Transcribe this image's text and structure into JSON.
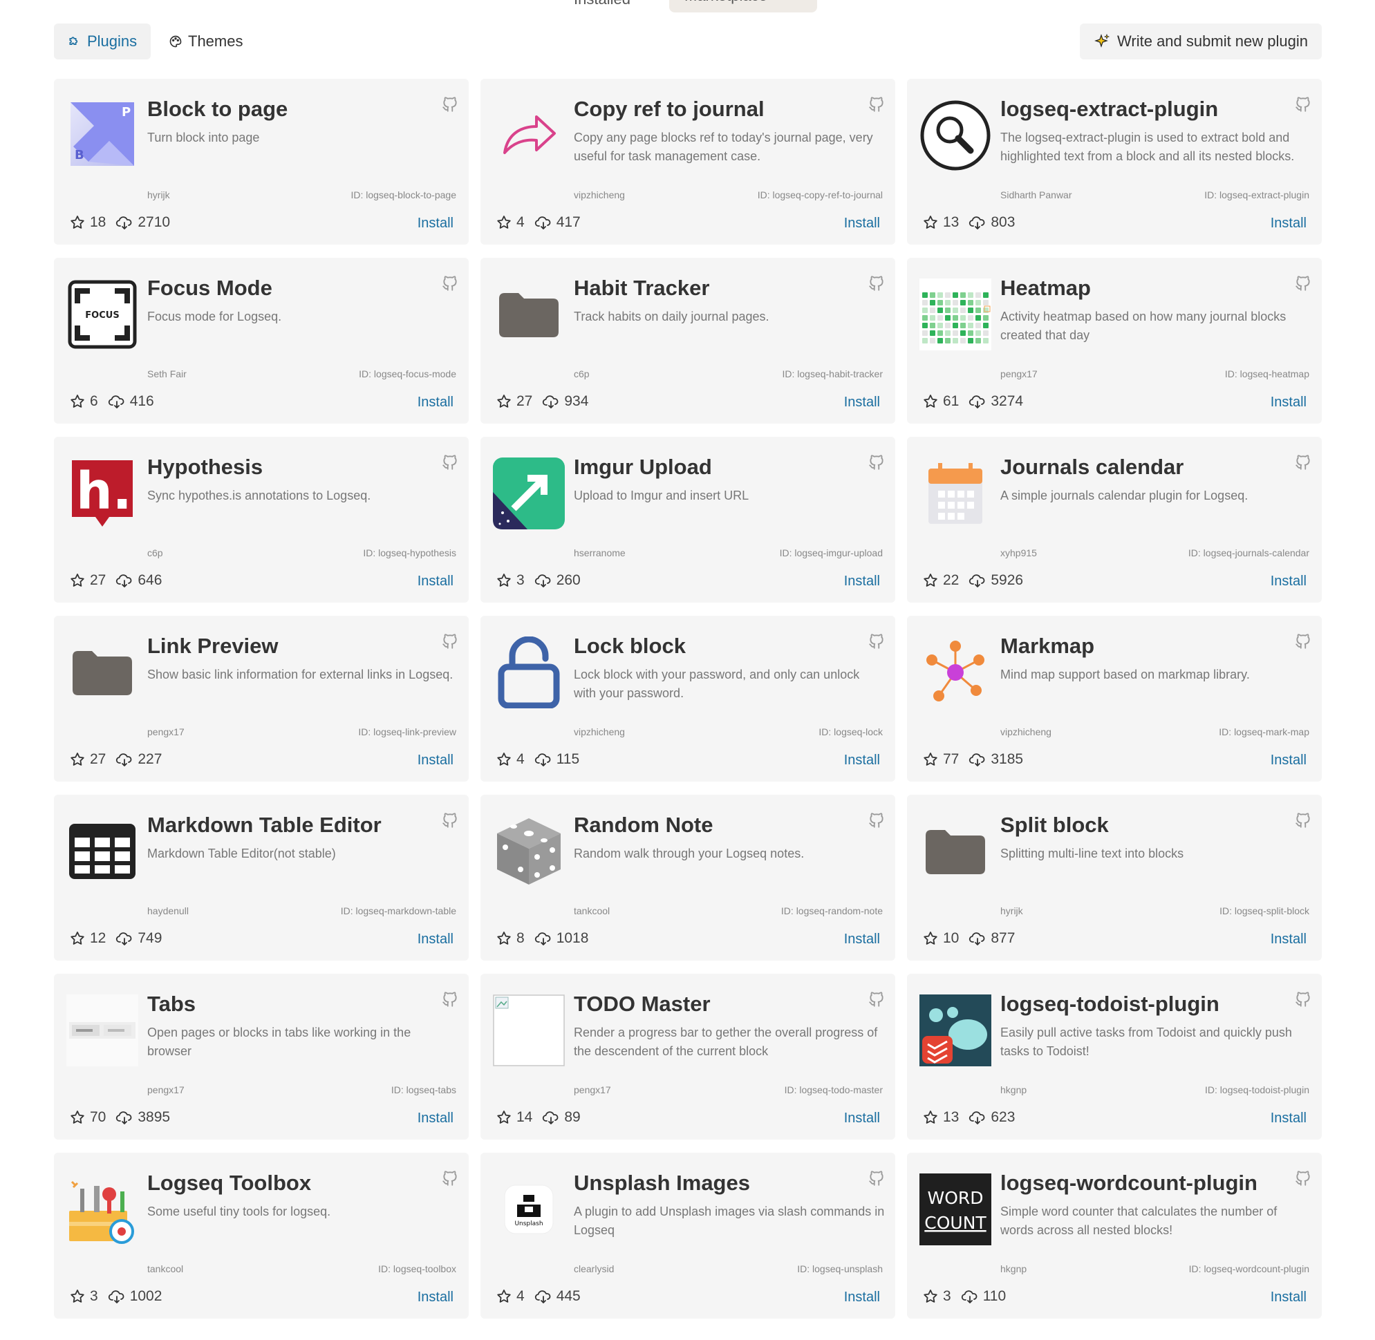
{
  "top_tabs": {
    "installed": "Installed",
    "marketplace": "Marketplace"
  },
  "toolbar": {
    "plugins_label": "Plugins",
    "themes_label": "Themes",
    "write_label": "Write and submit new plugin"
  },
  "install_label": "Install",
  "plugins": [
    {
      "title": "Block to page",
      "desc": "Turn block into page",
      "author": "hyrijk",
      "id": "ID: logseq-block-to-page",
      "stars": "18",
      "downloads": "2710",
      "icon": "block-to-page-icon"
    },
    {
      "title": "Copy ref to journal",
      "desc": "Copy any page blocks ref to today's journal page, very useful for task management case.",
      "author": "vipzhicheng",
      "id": "ID: logseq-copy-ref-to-journal",
      "stars": "4",
      "downloads": "417",
      "icon": "share-arrow-icon"
    },
    {
      "title": "logseq-extract-plugin",
      "desc": "The logseq-extract-plugin is used to extract bold and highlighted text from a block and all its nested blocks.",
      "author": "Sidharth Panwar",
      "id": "ID: logseq-extract-plugin",
      "stars": "13",
      "downloads": "803",
      "icon": "magnifier-icon"
    },
    {
      "title": "Focus Mode",
      "desc": "Focus mode for Logseq.",
      "author": "Seth Fair",
      "id": "ID: logseq-focus-mode",
      "stars": "6",
      "downloads": "416",
      "icon": "focus-icon",
      "icon_text": "FOCUS"
    },
    {
      "title": "Habit Tracker",
      "desc": "Track habits on daily journal pages.",
      "author": "c6p",
      "id": "ID: logseq-habit-tracker",
      "stars": "27",
      "downloads": "934",
      "icon": "folder-icon"
    },
    {
      "title": "Heatmap",
      "desc": "Activity heatmap based on how many journal blocks created that day",
      "author": "pengx17",
      "id": "ID: logseq-heatmap",
      "stars": "61",
      "downloads": "3274",
      "icon": "heatmap-icon"
    },
    {
      "title": "Hypothesis",
      "desc": "Sync hypothes.is annotations to Logseq.",
      "author": "c6p",
      "id": "ID: logseq-hypothesis",
      "stars": "27",
      "downloads": "646",
      "icon": "hypothesis-icon"
    },
    {
      "title": "Imgur Upload",
      "desc": "Upload to Imgur and insert URL",
      "author": "hserranome",
      "id": "ID: logseq-imgur-upload",
      "stars": "3",
      "downloads": "260",
      "icon": "imgur-icon"
    },
    {
      "title": "Journals calendar",
      "desc": "A simple journals calendar plugin for Logseq.",
      "author": "xyhp915",
      "id": "ID: logseq-journals-calendar",
      "stars": "22",
      "downloads": "5926",
      "icon": "calendar-icon"
    },
    {
      "title": "Link Preview",
      "desc": "Show basic link information for external links in Logseq.",
      "author": "pengx17",
      "id": "ID: logseq-link-preview",
      "stars": "27",
      "downloads": "227",
      "icon": "folder-icon"
    },
    {
      "title": "Lock block",
      "desc": "Lock block with your password, and only can unlock with your password.",
      "author": "vipzhicheng",
      "id": "ID: logseq-lock",
      "stars": "4",
      "downloads": "115",
      "icon": "unlock-icon"
    },
    {
      "title": "Markmap",
      "desc": "Mind map support based on markmap library.",
      "author": "vipzhicheng",
      "id": "ID: logseq-mark-map",
      "stars": "77",
      "downloads": "3185",
      "icon": "markmap-icon"
    },
    {
      "title": "Markdown Table Editor",
      "desc": "Markdown Table Editor(not stable)",
      "author": "haydenull",
      "id": "ID: logseq-markdown-table",
      "stars": "12",
      "downloads": "749",
      "icon": "table-icon"
    },
    {
      "title": "Random Note",
      "desc": "Random walk through your Logseq notes.",
      "author": "tankcool",
      "id": "ID: logseq-random-note",
      "stars": "8",
      "downloads": "1018",
      "icon": "dice-icon"
    },
    {
      "title": "Split block",
      "desc": "Splitting multi-line text into blocks",
      "author": "hyrijk",
      "id": "ID: logseq-split-block",
      "stars": "10",
      "downloads": "877",
      "icon": "folder-icon"
    },
    {
      "title": "Tabs",
      "desc": "Open pages or blocks in tabs like working in the browser",
      "author": "pengx17",
      "id": "ID: logseq-tabs",
      "stars": "70",
      "downloads": "3895",
      "icon": "tabs-icon"
    },
    {
      "title": "TODO Master",
      "desc": "Render a progress bar to gether the overall progress of the descendent of the current block",
      "author": "pengx17",
      "id": "ID: logseq-todo-master",
      "stars": "14",
      "downloads": "89",
      "icon": "broken-image-icon"
    },
    {
      "title": "logseq-todoist-plugin",
      "desc": "Easily pull active tasks from Todoist and quickly push tasks to Todoist!",
      "author": "hkgnp",
      "id": "ID: logseq-todoist-plugin",
      "stars": "13",
      "downloads": "623",
      "icon": "todoist-icon"
    },
    {
      "title": "Logseq Toolbox",
      "desc": "Some useful tiny tools for logseq.",
      "author": "tankcool",
      "id": "ID: logseq-toolbox",
      "stars": "3",
      "downloads": "1002",
      "icon": "toolbox-icon"
    },
    {
      "title": "Unsplash Images",
      "desc": "A plugin to add Unsplash images via slash commands in Logseq",
      "author": "clearlysid",
      "id": "ID: logseq-unsplash",
      "stars": "4",
      "downloads": "445",
      "icon": "unsplash-icon",
      "icon_text": "Unsplash"
    },
    {
      "title": "logseq-wordcount-plugin",
      "desc": "Simple word counter that calculates the number of words across all nested blocks!",
      "author": "hkgnp",
      "id": "ID: logseq-wordcount-plugin",
      "stars": "3",
      "downloads": "110",
      "icon": "wordcount-icon",
      "icon_text": "WORD COUNT"
    }
  ]
}
